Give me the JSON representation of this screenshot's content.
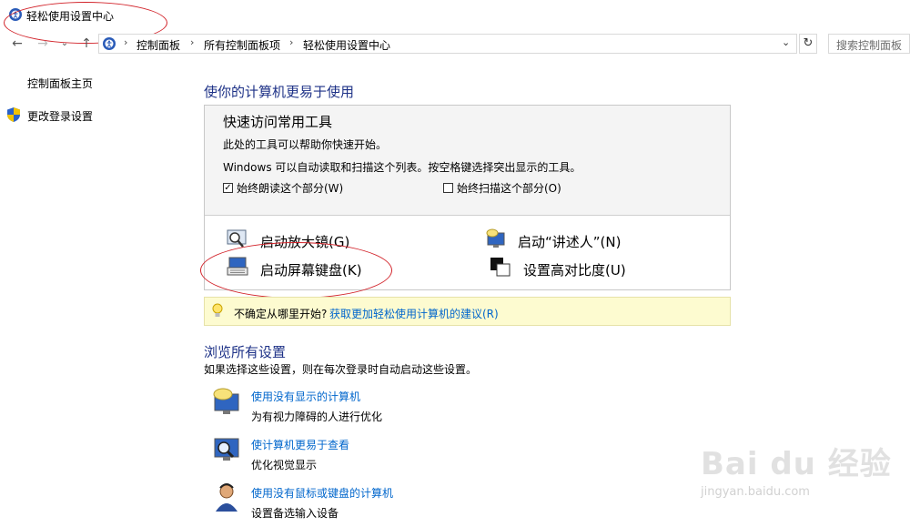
{
  "window": {
    "title": "轻松使用设置中心"
  },
  "address": {
    "crumbs": [
      "控制面板",
      "所有控制面板项",
      "轻松使用设置中心"
    ],
    "search_placeholder": "搜索控制面板"
  },
  "sidebar": {
    "items": [
      {
        "label": "控制面板主页"
      },
      {
        "label": "更改登录设置"
      }
    ]
  },
  "main": {
    "heading": "使你的计算机更易于使用",
    "quick_access": {
      "title": "快速访问常用工具",
      "desc1": "此处的工具可以帮助你快速开始。",
      "desc2": "Windows 可以自动读取和扫描这个列表。按空格键选择突出显示的工具。",
      "checkbox_read": {
        "label": "始终朗读这个部分(W)",
        "checked": true
      },
      "checkbox_scan": {
        "label": "始终扫描这个部分(O)",
        "checked": false
      },
      "tools": [
        {
          "label": "启动放大镜(G)",
          "icon": "magnifier-icon"
        },
        {
          "label": "启动“讲述人”(N)",
          "icon": "narrator-icon"
        },
        {
          "label": "启动屏幕键盘(K)",
          "icon": "keyboard-icon"
        },
        {
          "label": "设置高对比度(U)",
          "icon": "contrast-icon"
        }
      ]
    },
    "tip": {
      "text": "不确定从哪里开始?",
      "link": "获取更加轻松使用计算机的建议(R)"
    },
    "browse": {
      "heading": "浏览所有设置",
      "desc": "如果选择这些设置，则在每次登录时自动启动这些设置。",
      "items": [
        {
          "link": "使用没有显示的计算机",
          "desc": "为有视力障碍的人进行优化",
          "icon": "speech-monitor-icon"
        },
        {
          "link": "使计算机更易于查看",
          "desc": "优化视觉显示",
          "icon": "magnify-monitor-icon"
        },
        {
          "link": "使用没有鼠标或键盘的计算机",
          "desc": "设置备选输入设备",
          "icon": "person-headset-icon"
        }
      ]
    }
  },
  "watermark": {
    "brand": "Bai du 经验",
    "url": "jingyan.baidu.com"
  },
  "colors": {
    "heading": "#1e3287",
    "link": "#0066cc",
    "annotation": "#d2232a",
    "tip_bg": "#fdfbd0"
  }
}
